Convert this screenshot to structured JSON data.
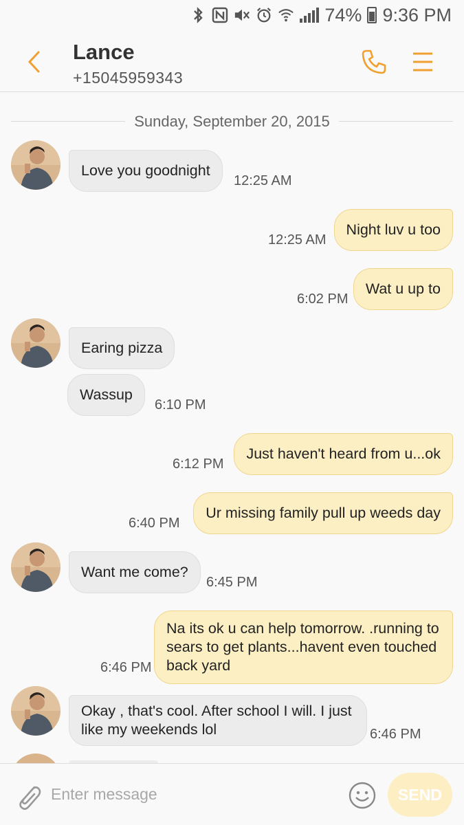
{
  "status_bar": {
    "battery": "74%",
    "time": "9:36 PM",
    "icons": [
      "bluetooth-icon",
      "nfc-icon",
      "mute-icon",
      "alarm-icon",
      "wifi-icon",
      "signal-icon",
      "battery-icon"
    ]
  },
  "header": {
    "name": "Lance",
    "number": "+15045959343",
    "back_icon": "back-arrow-icon",
    "call_icon": "phone-icon",
    "menu_icon": "menu-icon",
    "accent_color": "#f0a030"
  },
  "date_divider": "Sunday, September 20, 2015",
  "messages": [
    {
      "dir": "in",
      "text": "Love you goodnight",
      "time": "12:25 AM"
    },
    {
      "dir": "out",
      "text": "Night luv u too",
      "time": "12:25 AM"
    },
    {
      "dir": "out",
      "text": "Wat u up to",
      "time": "6:02 PM"
    },
    {
      "dir": "in",
      "text": "Earing pizza",
      "time": ""
    },
    {
      "dir": "in",
      "text": "Wassup",
      "time": "6:10 PM"
    },
    {
      "dir": "out",
      "text": "Just haven't heard from u...ok",
      "time": "6:12 PM"
    },
    {
      "dir": "out",
      "text": "Ur missing family pull up weeds day",
      "time": "6:40 PM"
    },
    {
      "dir": "in",
      "text": "Want me come?",
      "time": "6:45 PM"
    },
    {
      "dir": "out",
      "text": "Na its ok u can help tomorrow. .running to sears to get plants...havent even touched back yard",
      "time": "6:46 PM"
    },
    {
      "dir": "in",
      "text": "Okay , that's cool. After school I will. I just like my weekends lol",
      "time": "6:46 PM"
    }
  ],
  "composer": {
    "placeholder": "Enter message",
    "send_label": "SEND",
    "attach_icon": "paperclip-icon",
    "emoji_icon": "smiley-icon"
  },
  "colors": {
    "incoming_bubble": "#ececec",
    "outgoing_bubble": "#fdefc4",
    "outgoing_border": "#f1d58e",
    "send_button": "#fdeec4"
  }
}
